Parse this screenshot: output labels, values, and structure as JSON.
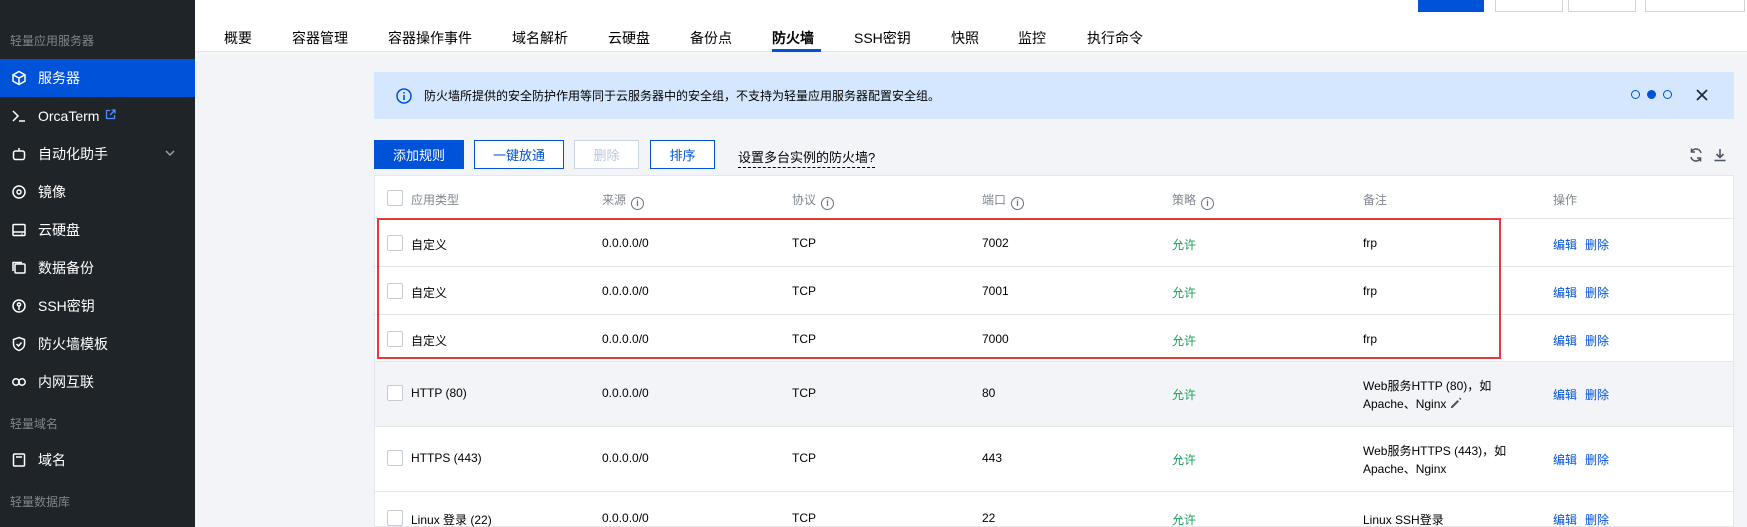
{
  "sidebar": {
    "group1": "轻量应用服务器",
    "items": [
      {
        "label": "服务器",
        "icon": "cube-icon"
      },
      {
        "label": "OrcaTerm",
        "icon": "terminal-icon"
      },
      {
        "label": "自动化助手",
        "icon": "robot-icon"
      },
      {
        "label": "镜像",
        "icon": "disc-icon"
      },
      {
        "label": "云硬盘",
        "icon": "disk-icon"
      },
      {
        "label": "数据备份",
        "icon": "backup-icon"
      },
      {
        "label": "SSH密钥",
        "icon": "key-icon"
      },
      {
        "label": "防火墙模板",
        "icon": "shield-icon"
      },
      {
        "label": "内网互联",
        "icon": "link-icon"
      }
    ],
    "group2": "轻量域名",
    "domain_item": "域名",
    "group3": "轻量数据库"
  },
  "tabs": [
    "概要",
    "容器管理",
    "容器操作事件",
    "域名解析",
    "云硬盘",
    "备份点",
    "防火墙",
    "SSH密钥",
    "快照",
    "监控",
    "执行命令"
  ],
  "active_tab": "防火墙",
  "notice": {
    "text": "防火墙所提供的安全防护作用等同于云服务器中的安全组，不支持为轻量应用服务器配置安全组。"
  },
  "toolbar": {
    "add_rule": "添加规则",
    "one_click_allow": "一键放通",
    "delete": "删除",
    "sort": "排序",
    "help_link": "设置多台实例的防火墙?"
  },
  "table": {
    "headers": {
      "app_type": "应用类型",
      "source": "来源",
      "protocol": "协议",
      "port": "端口",
      "policy": "策略",
      "remark": "备注",
      "action": "操作"
    },
    "rows": [
      {
        "app_type": "自定义",
        "source": "0.0.0.0/0",
        "protocol": "TCP",
        "port": "7002",
        "policy": "允许",
        "remark": "frp",
        "edit": "编辑",
        "delete": "删除"
      },
      {
        "app_type": "自定义",
        "source": "0.0.0.0/0",
        "protocol": "TCP",
        "port": "7001",
        "policy": "允许",
        "remark": "frp",
        "edit": "编辑",
        "delete": "删除"
      },
      {
        "app_type": "自定义",
        "source": "0.0.0.0/0",
        "protocol": "TCP",
        "port": "7000",
        "policy": "允许",
        "remark": "frp",
        "edit": "编辑",
        "delete": "删除"
      },
      {
        "app_type": "HTTP (80)",
        "source": "0.0.0.0/0",
        "protocol": "TCP",
        "port": "80",
        "policy": "允许",
        "remark": "Web服务HTTP (80)，如Apache、Nginx",
        "edit": "编辑",
        "delete": "删除"
      },
      {
        "app_type": "HTTPS (443)",
        "source": "0.0.0.0/0",
        "protocol": "TCP",
        "port": "443",
        "policy": "允许",
        "remark": "Web服务HTTPS (443)，如Apache、Nginx",
        "edit": "编辑",
        "delete": "删除"
      },
      {
        "app_type": "Linux 登录 (22)",
        "source": "0.0.0.0/0",
        "protocol": "TCP",
        "port": "22",
        "policy": "允许",
        "remark": "Linux SSH登录",
        "edit": "编辑",
        "delete": "删除"
      }
    ]
  },
  "colors": {
    "accent": "#0052d9",
    "sidebar_bg": "#1f2428",
    "allow_green": "#18a058",
    "highlight_red": "#e5393a",
    "notice_bg": "#d5e7ff"
  }
}
